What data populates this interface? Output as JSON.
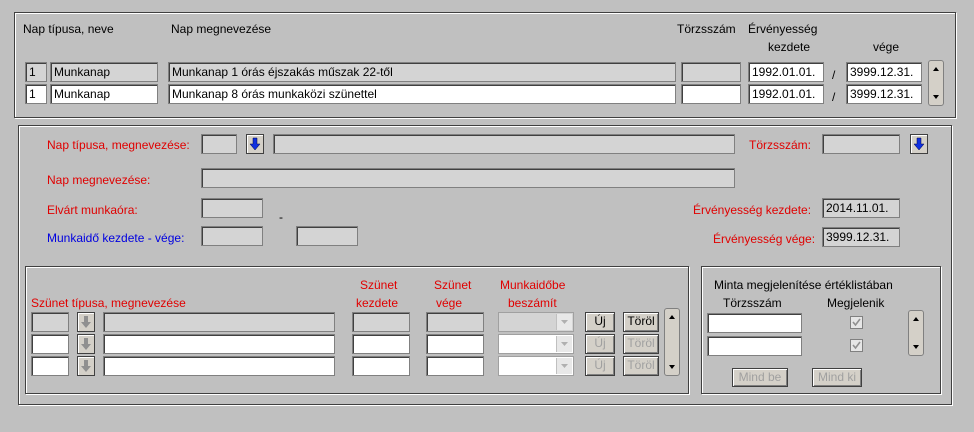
{
  "list_header": {
    "col_type": "Nap típusa, neve",
    "col_name": "Nap megnevezése",
    "col_torzs": "Törzsszám",
    "col_erv": "Érvényesség",
    "col_kezdete": "kezdete",
    "col_vege": "vége"
  },
  "rows": [
    {
      "num": "1",
      "type": "Munkanap",
      "name": "Munkanap 1 órás éjszakás műszak 22-től",
      "torzs": "",
      "start": "1992.01.01.",
      "sep": "/",
      "end": "3999.12.31."
    },
    {
      "num": "1",
      "type": "Munkanap",
      "name": "Munkanap 8 órás munkaközi szünettel",
      "torzs": "",
      "start": "1992.01.01.",
      "sep": "/",
      "end": "3999.12.31."
    }
  ],
  "form": {
    "nap_tipusa_label": "Nap típusa, megnevezése:",
    "torzsszam_label": "Törzsszám:",
    "nap_megnevezese_label": "Nap megnevezése:",
    "elvart_label": "Elvárt munkaóra:",
    "dash": "-",
    "munkaido_label": "Munkaidő kezdete - vége:",
    "erv_kezdete_label": "Érvényesség kezdete:",
    "erv_kezdete_value": "2014.11.01.",
    "erv_vege_label": "Érvényesség vége:",
    "erv_vege_value": "3999.12.31."
  },
  "breaks": {
    "col_type": "Szünet típusa, megnevezése",
    "col_start_1": "Szünet",
    "col_start_2": "kezdete",
    "col_end_1": "Szünet",
    "col_end_2": "vége",
    "col_count_1": "Munkaidőbe",
    "col_count_2": "beszámít",
    "new_label": "Új",
    "delete_label": "Töröl"
  },
  "sample": {
    "title": "Minta megjelenítése értéklistában",
    "col_torzs": "Törzsszám",
    "col_shown": "Megjelenik",
    "all_on": "Mind be",
    "all_off": "Mind ki"
  },
  "colors": {
    "label_red": "#e00000",
    "label_blue": "#0000e0",
    "background": "#c0c0c0"
  },
  "icons": [
    "arrow-down-icon",
    "scroll-up-icon",
    "scroll-down-icon",
    "checkbox-icon"
  ]
}
